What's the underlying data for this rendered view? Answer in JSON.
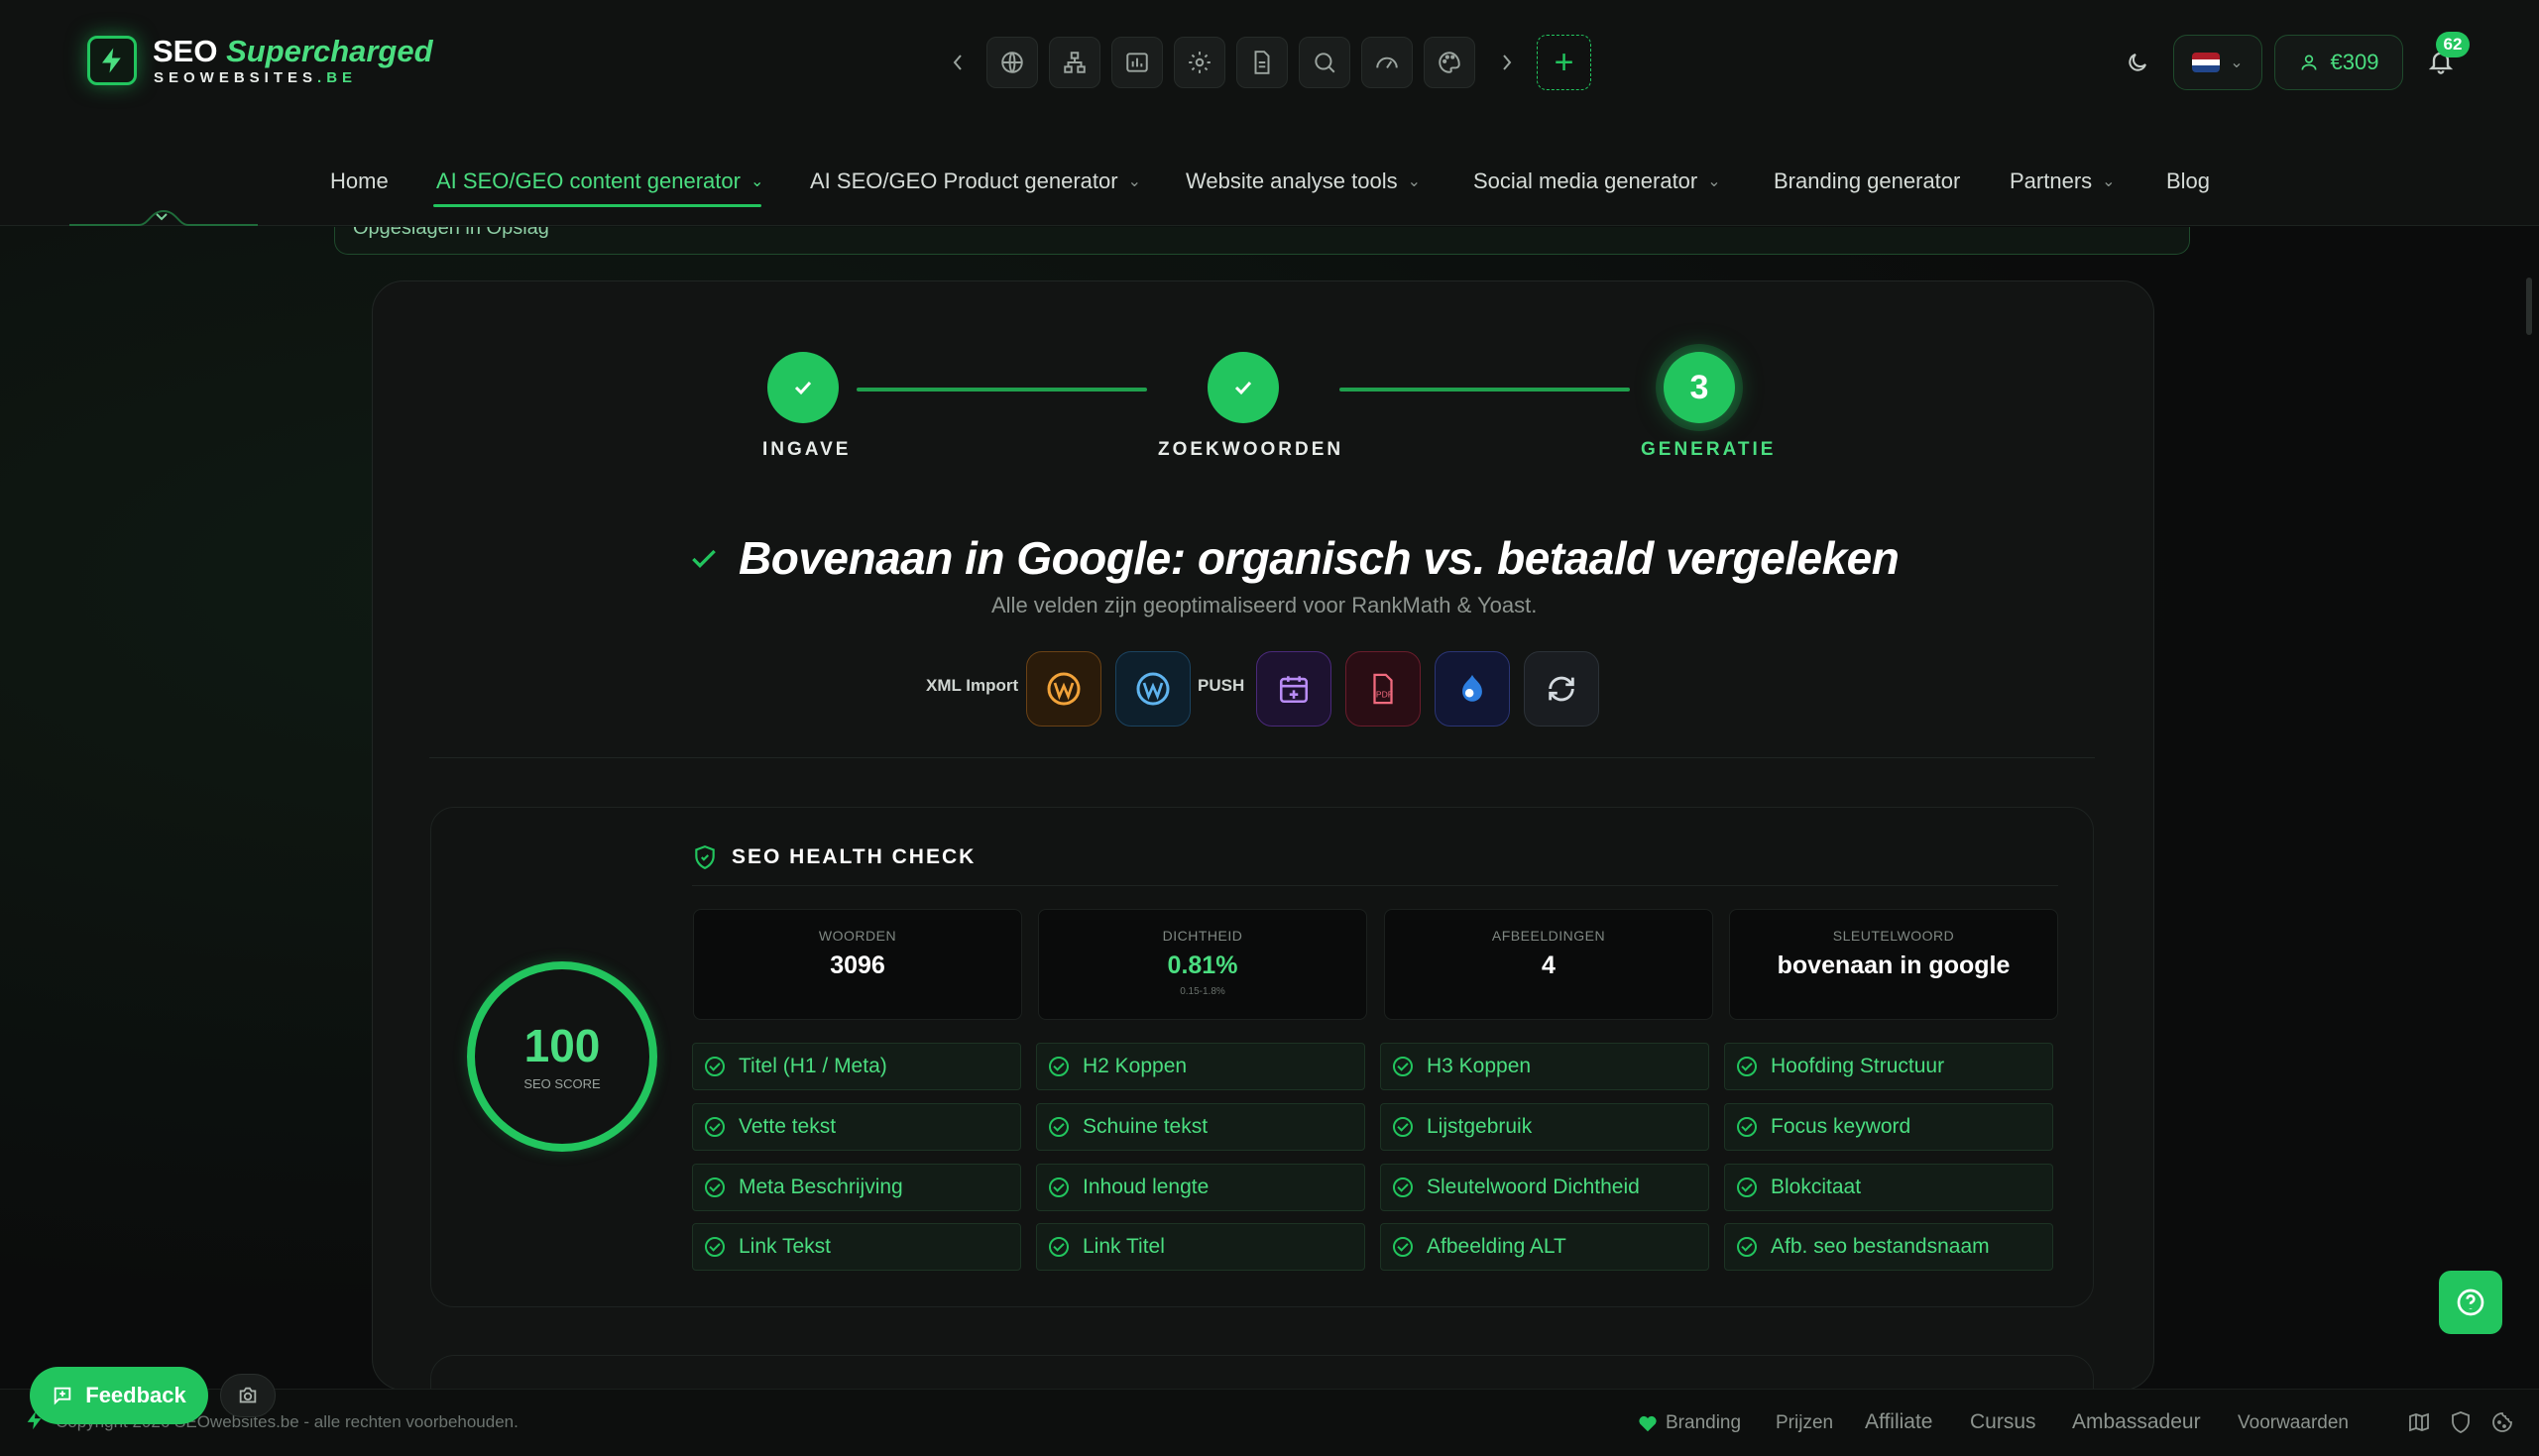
{
  "brand": {
    "name_part1": "SEO",
    "name_part2": "Supercharged",
    "sub_part1": "SEOWEBSITES",
    "sub_part2": ".BE"
  },
  "header": {
    "balance": "€309",
    "notifications_count": "62",
    "language_flag": "nl"
  },
  "toolbar_icons": [
    "globe-icon",
    "sitemap-icon",
    "chart-icon",
    "settings-icon",
    "document-icon",
    "search-icon",
    "gauge-icon",
    "palette-icon"
  ],
  "nav": {
    "items": [
      {
        "label": "Home",
        "dropdown": false
      },
      {
        "label": "AI SEO/GEO content generator",
        "dropdown": true,
        "active": true
      },
      {
        "label": "AI SEO/GEO Product generator",
        "dropdown": true
      },
      {
        "label": "Website analyse tools",
        "dropdown": true
      },
      {
        "label": "Social media generator",
        "dropdown": true
      },
      {
        "label": "Branding generator",
        "dropdown": false
      },
      {
        "label": "Partners",
        "dropdown": true
      },
      {
        "label": "Blog",
        "dropdown": false
      }
    ]
  },
  "saved_banner": "Opgeslagen in Opslag",
  "steps": [
    {
      "label": "INGAVE",
      "state": "done"
    },
    {
      "label": "ZOEKWOORDEN",
      "state": "done"
    },
    {
      "label": "GENERATIE",
      "state": "active",
      "number": "3"
    }
  ],
  "article": {
    "title": "Bovenaan in Google: organisch vs. betaald vergeleken",
    "subtitle": "Alle velden zijn geoptimaliseerd voor RankMath & Yoast."
  },
  "export": {
    "xml_label": "XML Import",
    "push_label": "PUSH",
    "pdf_label": "PDF"
  },
  "health": {
    "title": "SEO HEALTH CHECK",
    "score": "100",
    "score_label": "SEO SCORE",
    "stats": [
      {
        "label": "WOORDEN",
        "value": "3096"
      },
      {
        "label": "DICHTHEID",
        "value": "0.81%",
        "note": "0.15-1.8%"
      },
      {
        "label": "AFBEELDINGEN",
        "value": "4"
      },
      {
        "label": "SLEUTELWOORD",
        "value": "bovenaan in google"
      }
    ],
    "checks": [
      "Titel (H1 / Meta)",
      "H2 Koppen",
      "H3 Koppen",
      "Hoofding Structuur",
      "Vette tekst",
      "Schuine tekst",
      "Lijstgebruik",
      "Focus keyword",
      "Meta Beschrijving",
      "Inhoud lengte",
      "Sleutelwoord Dichtheid",
      "Blokcitaat",
      "Link Tekst",
      "Link Titel",
      "Afbeelding ALT",
      "Afb. seo bestandsnaam"
    ]
  },
  "feedback_label": "Feedback",
  "footer": {
    "copyright": "Copyright 2026 SEOwebsites.be - alle rechten voorbehouden.",
    "links": [
      "Branding",
      "Prijzen",
      "Affiliate",
      "Cursus",
      "Ambassadeur",
      "Voorwaarden"
    ]
  },
  "colors": {
    "accent": "#22c55e",
    "accent_light": "#4ade80",
    "bg": "#0b0c0c"
  }
}
